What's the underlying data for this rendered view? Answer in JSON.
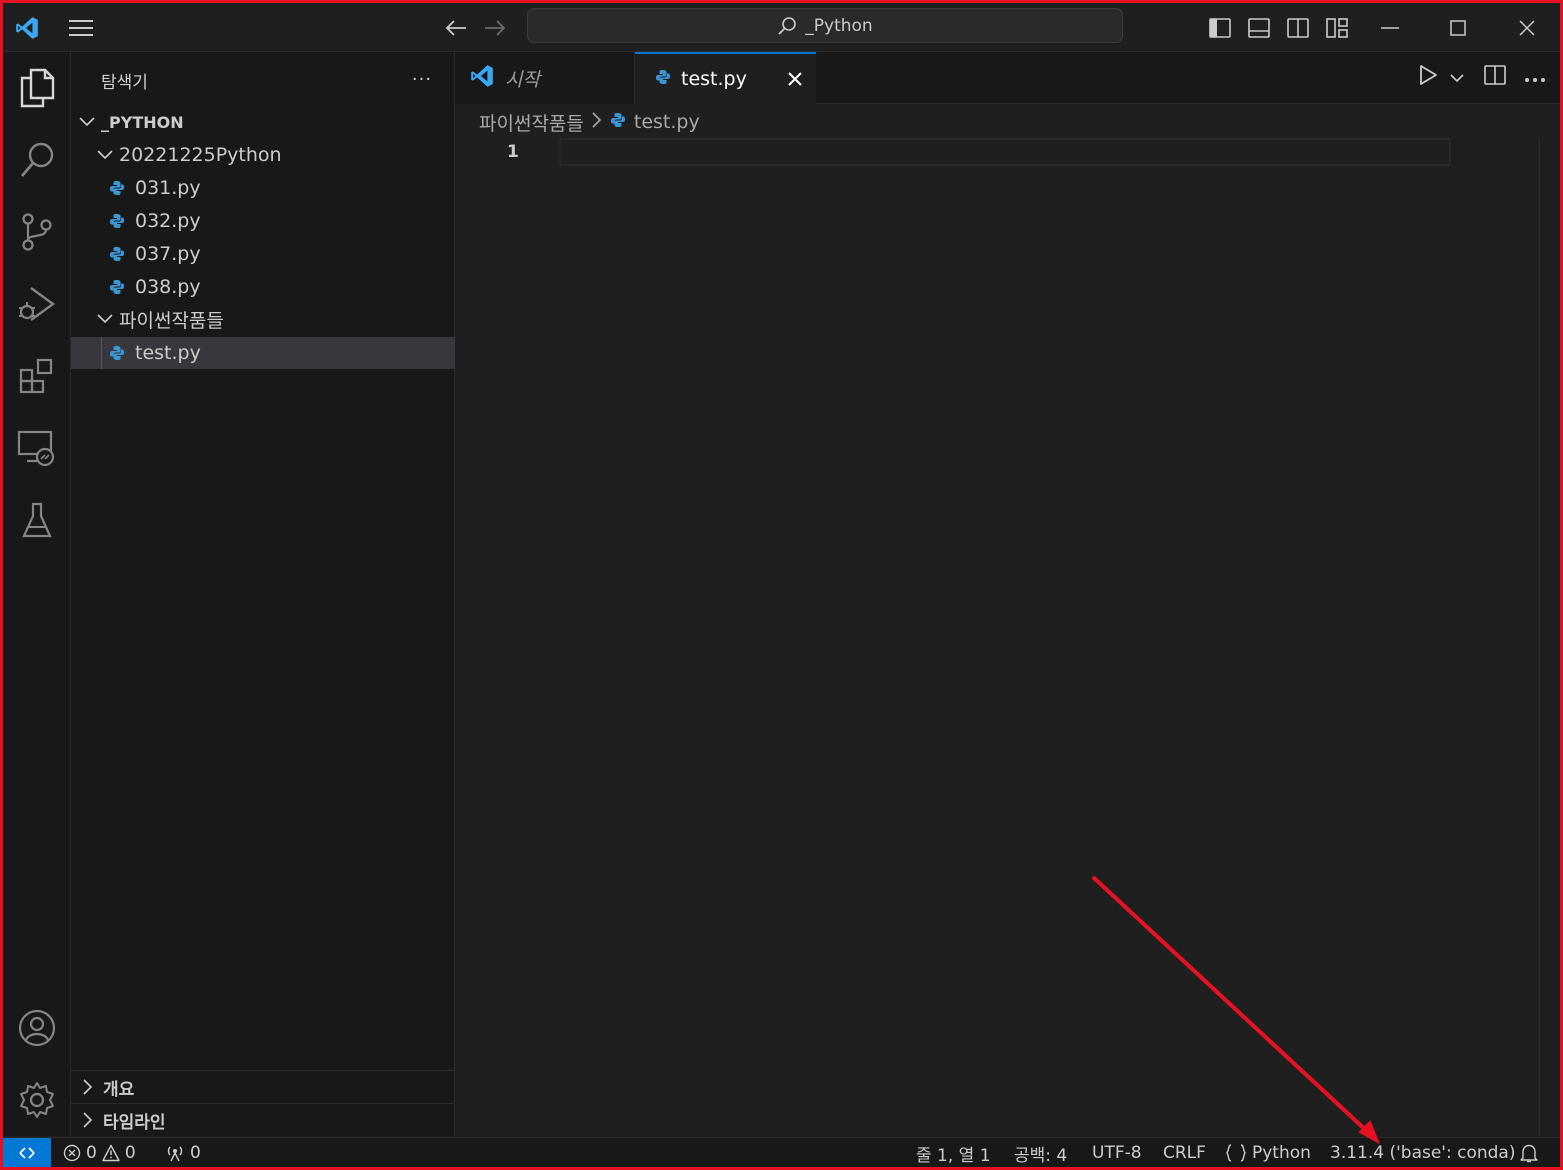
{
  "titlebar": {
    "search_text": "_Python",
    "menu_icon": "hamburger-menu-icon",
    "back_icon": "arrow-left-icon",
    "forward_icon": "arrow-right-icon",
    "layout_icons": [
      "toggle-primary-sidebar-icon",
      "toggle-panel-icon",
      "toggle-secondary-sidebar-icon",
      "customize-layout-icon"
    ],
    "window_controls": [
      "minimize-icon",
      "maximize-icon",
      "close-icon"
    ]
  },
  "activity_bar": {
    "top": [
      "explorer-icon",
      "search-icon",
      "source-control-icon",
      "run-debug-icon",
      "extensions-icon",
      "remote-explorer-icon",
      "testing-icon"
    ],
    "bottom": [
      "accounts-icon",
      "manage-gear-icon"
    ]
  },
  "sidebar": {
    "title": "탐색기",
    "more": "···",
    "root": "_PYTHON",
    "folders": [
      {
        "name": "20221225Python",
        "files": [
          "031.py",
          "032.py",
          "037.py",
          "038.py"
        ]
      },
      {
        "name": "파이썬작품들",
        "files": [
          "test.py"
        ]
      }
    ],
    "panels": [
      "개요",
      "타임라인"
    ]
  },
  "tabs": [
    {
      "label": "시작",
      "active": false
    },
    {
      "label": "test.py",
      "active": true
    }
  ],
  "breadcrumb": {
    "folder": "파이썬작품들",
    "file": "test.py"
  },
  "editor": {
    "line_number": "1"
  },
  "statusbar": {
    "errors": "0",
    "warnings": "0",
    "ports": "0",
    "position": "줄 1, 열 1",
    "indent": "공백: 4",
    "encoding": "UTF-8",
    "eol": "CRLF",
    "language": "Python",
    "interpreter": "3.11.4 ('base': conda)"
  },
  "colors": {
    "accent": "#0078d4",
    "annotation": "#e81123",
    "python_icon": "#3b97d3"
  }
}
